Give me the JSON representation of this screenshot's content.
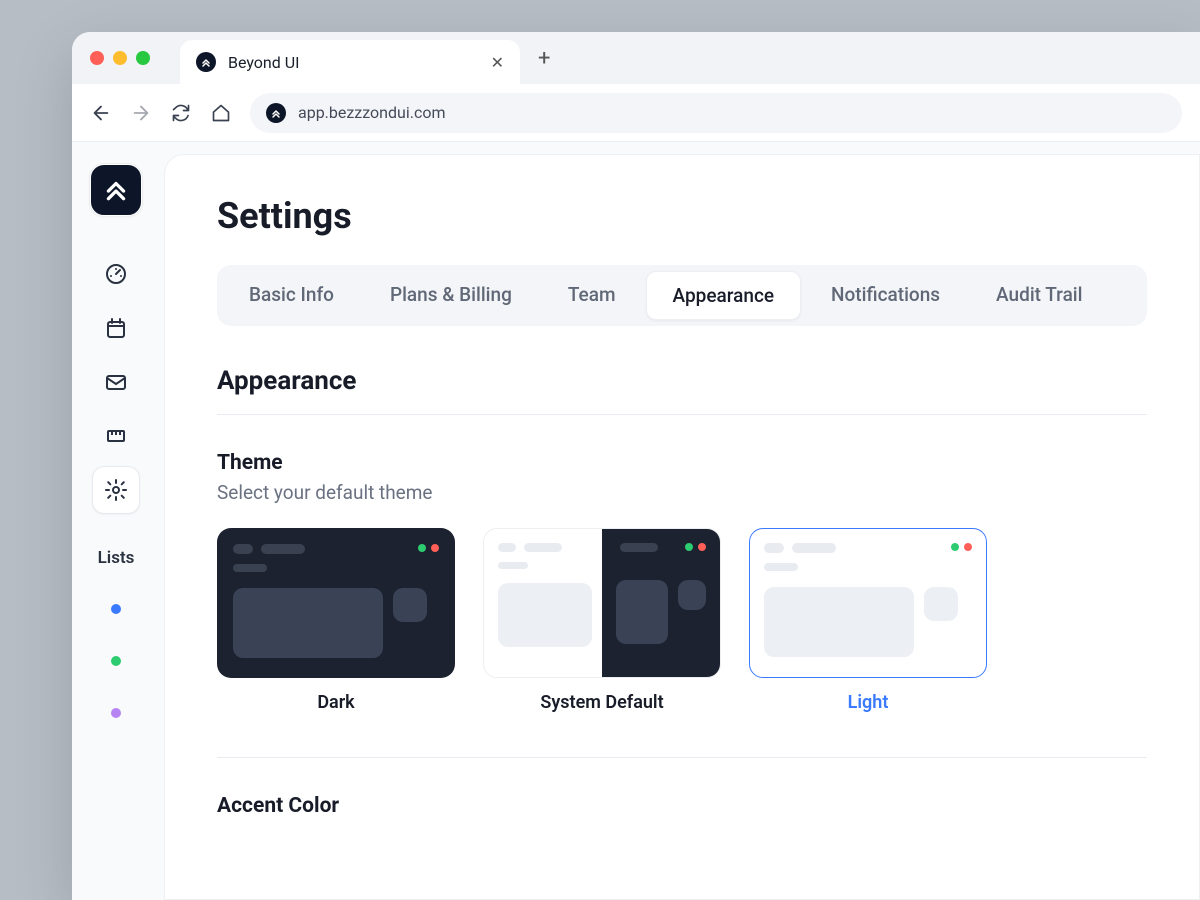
{
  "browser": {
    "tab_title": "Beyond UI",
    "url": "app.bezzzondui.com"
  },
  "sidebar": {
    "lists_label": "Lists",
    "list_colors": [
      "#3a7afe",
      "#2ecc71",
      "#b784f4"
    ]
  },
  "page": {
    "title": "Settings",
    "tabs": [
      {
        "label": "Basic Info",
        "active": false
      },
      {
        "label": "Plans & Billing",
        "active": false
      },
      {
        "label": "Team",
        "active": false
      },
      {
        "label": "Appearance",
        "active": true
      },
      {
        "label": "Notifications",
        "active": false
      },
      {
        "label": "Audit Trail",
        "active": false
      }
    ],
    "section_title": "Appearance",
    "theme": {
      "title": "Theme",
      "description": "Select your default theme",
      "options": [
        {
          "label": "Dark",
          "selected": false
        },
        {
          "label": "System Default",
          "selected": false
        },
        {
          "label": "Light",
          "selected": true
        }
      ]
    },
    "accent_title": "Accent Color"
  }
}
